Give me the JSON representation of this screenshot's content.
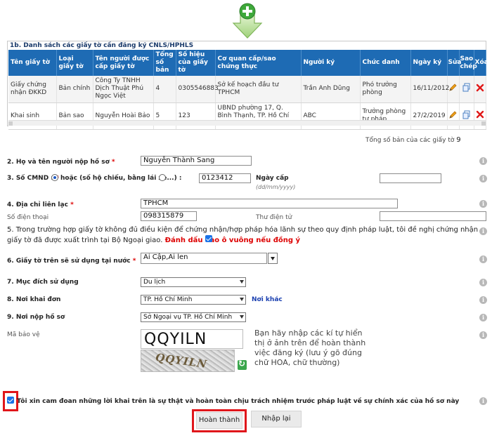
{
  "doc_list": {
    "title": "1b. Danh sách các giấy tờ cần đăng ký CNLS/HPHLS",
    "columns": [
      "Tên giấy tờ",
      "Loại giấy tờ",
      "Tên người được cấp giấy tờ",
      "Tổng số bản",
      "Số hiệu của giấy tờ",
      "Cơ quan cấp/sao chứng thực",
      "Người ký",
      "Chức danh",
      "Ngày ký",
      "Sửa",
      "Sao chép",
      "Xóa"
    ],
    "rows": [
      [
        "Giấy chứng nhận ĐKKD",
        "Bản chính",
        "Công Ty TNHH Dịch Thuật Phú Ngọc Việt",
        "4",
        "0305546883",
        "Sở kế hoạch đầu tư TPHCM",
        "Trần Anh Dũng",
        "Phó trưởng phòng",
        "16/11/2012"
      ],
      [
        "Khai sinh",
        "Bản sao",
        "Nguyễn Hoài Bảo",
        "5",
        "123",
        "UBND phường 17, Q. Bình Thạnh, TP. Hồ Chí Minh",
        "ABC",
        "Trưởng phòng tư pháp",
        "27/2/2019"
      ]
    ],
    "total_label": "Tổng số bản của các giấy tờ",
    "total_value": "9"
  },
  "form": {
    "name_label": "2. Họ và tên người nộp hồ sơ",
    "name_value": "Nguyễn Thành  Sang",
    "cmnd_label": "3. Số CMND :",
    "cmnd_alt_label": "hoặc (số hộ chiếu, bằng lái xe...) :",
    "cmnd_value": "0123412",
    "issue_date_label": "Ngày cấp",
    "issue_date_hint": "(dd/mm/yyyy)",
    "issue_date_value": "",
    "address_label": "4. Địa chỉ liên lạc",
    "address_value": "TPHCM",
    "phone_label": "Số điện thoại",
    "phone_value": "098315879",
    "email_label": "Thư điện tử",
    "email_value": "",
    "note_text": "5. Trong trường hợp giấy tờ không đủ điều kiện để chứng nhận/hợp pháp hóa lãnh sự theo quy định pháp luật, tôi đề nghị chứng nhận giấy tờ đã được xuất trình tại Bộ Ngoại giao.",
    "note_check_label": "Đánh dấu vào ô vuông nếu đồng ý",
    "country_label": "6. Giấy tờ trên sẽ sử dụng tại nước",
    "country_value": "Ai Cập,Ai len",
    "purpose_label": "7. Mục đích sử dụng",
    "purpose_value": "Du lịch",
    "declare_place_label": "8. Nơi khai đơn",
    "declare_place_value": "TP. Hồ Chí Minh",
    "other_place_link": "Nơi khác",
    "submit_place_label": "9. Nơi nộp hồ sơ",
    "submit_place_value": "Sở Ngoại vụ TP. Hồ Chí Minh",
    "captcha_label": "Mã bảo vệ",
    "captcha_value": "QQYILN",
    "captcha_image_text": "QQYILN",
    "captcha_help": "Bạn hãy nhập các kí tự hiển thị ở ảnh trên để hoàn thành việc đăng ký (lưu ý gõ đúng chữ HOA, chữ thường)",
    "commit_text": "Tôi xin cam đoan những lời khai trên là sự thật và hoàn toàn chịu trách nhiệm trước pháp luật về sự chính xác của hồ sơ này",
    "required_mark": "*"
  },
  "buttons": {
    "finish": "Hoàn thành",
    "reset": "Nhập lại"
  },
  "colors": {
    "header_blue": "#1e6bb4",
    "required_red": "#dd0000",
    "highlight_red": "#e0161b",
    "add_green": "#4caf3c"
  },
  "icons": {
    "add": "plus-arrow-icon",
    "edit": "pencil-icon",
    "copy": "copy-icon",
    "delete": "x-icon",
    "info": "info-icon",
    "refresh": "refresh-icon"
  }
}
